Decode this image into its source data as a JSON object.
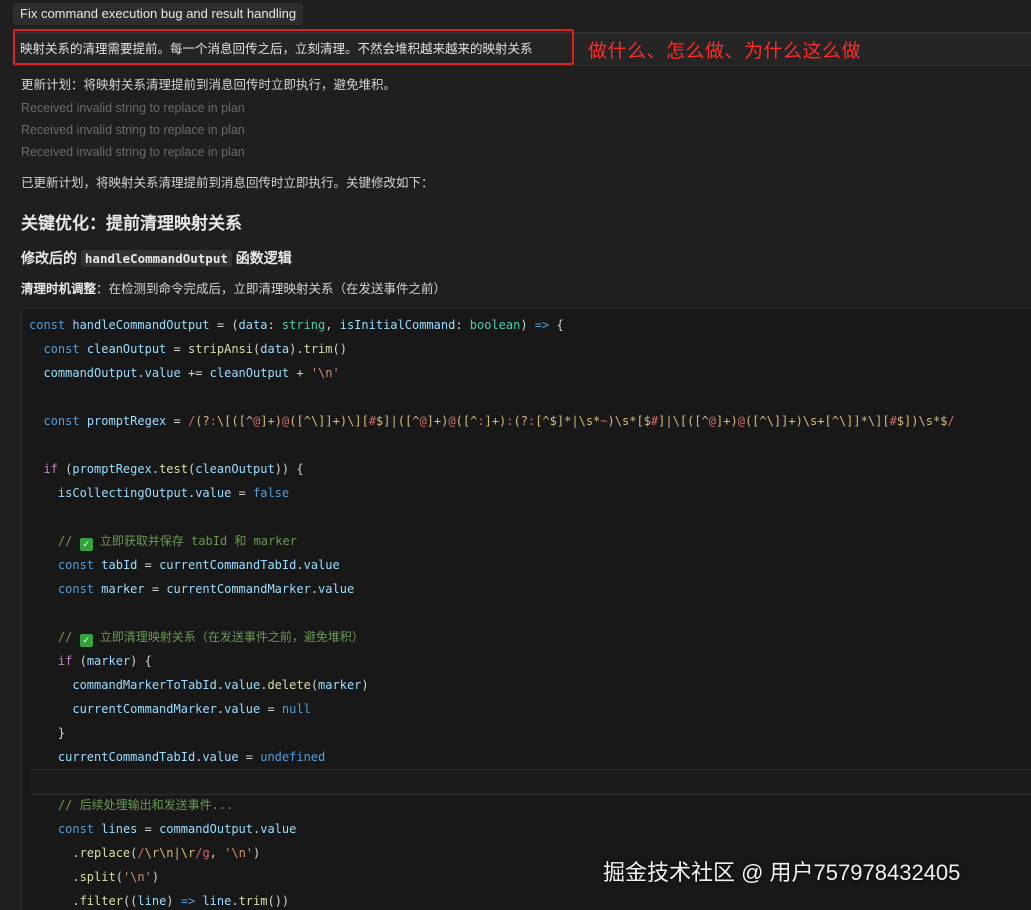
{
  "task": {
    "title": "Fix command execution bug and result handling"
  },
  "prompt": {
    "text": "映射关系的清理需要提前。每一个消息回传之后，立刻清理。不然会堆积越来越来的映射关系"
  },
  "annotation": {
    "text": "做什么、怎么做、为什么这么做"
  },
  "messages": {
    "update_plan": "更新计划：将映射关系清理提前到消息回传时立即执行，避免堆积。",
    "invalid_1": "Received invalid string to replace in plan",
    "invalid_2": "Received invalid string to replace in plan",
    "invalid_3": "Received invalid string to replace in plan",
    "updated": "已更新计划，将映射关系清理提前到消息回传时立即执行。关键修改如下："
  },
  "heading": "关键优化：提前清理映射关系",
  "subheading": {
    "prefix": "修改后的 ",
    "code": "handleCommandOutput",
    "suffix": " 函数逻辑"
  },
  "note": {
    "label": "清理时机调整",
    "text": "：在检测到命令完成后，立即清理映射关系（在发送事件之前）"
  },
  "code": {
    "language": "typescript",
    "lines": [
      "const handleCommandOutput = (data: string, isInitialCommand: boolean) => {",
      "  const cleanOutput = stripAnsi(data).trim()",
      "  commandOutput.value += cleanOutput + '\\n'",
      "",
      "  const promptRegex = /(?:\\[([^@]+)@([^\\]]+)\\][#$]|([^@]+)@([^:]+):(?:[^$]*|\\s*~)\\s*[$#]|\\[([^@]+)@([^\\]]+)\\s+[^\\]]*\\][#$])\\s*$/",
      "",
      "  if (promptRegex.test(cleanOutput)) {",
      "    isCollectingOutput.value = false",
      "",
      "    // ✅ 立即获取并保存 tabId 和 marker",
      "    const tabId = currentCommandTabId.value",
      "    const marker = currentCommandMarker.value",
      "",
      "    // ✅ 立即清理映射关系（在发送事件之前，避免堆积）",
      "    if (marker) {",
      "      commandMarkerToTabId.value.delete(marker)",
      "      currentCommandMarker.value = null",
      "    }",
      "    currentCommandTabId.value = undefined",
      "",
      "    // 后续处理输出和发送事件...",
      "    const lines = commandOutput.value",
      "      .replace(/\\r\\n|\\r/g, '\\n')",
      "      .split('\\n')",
      "      .filter((line) => line.trim())"
    ]
  },
  "watermark": "掘金技术社区 @ 用户757978432405"
}
